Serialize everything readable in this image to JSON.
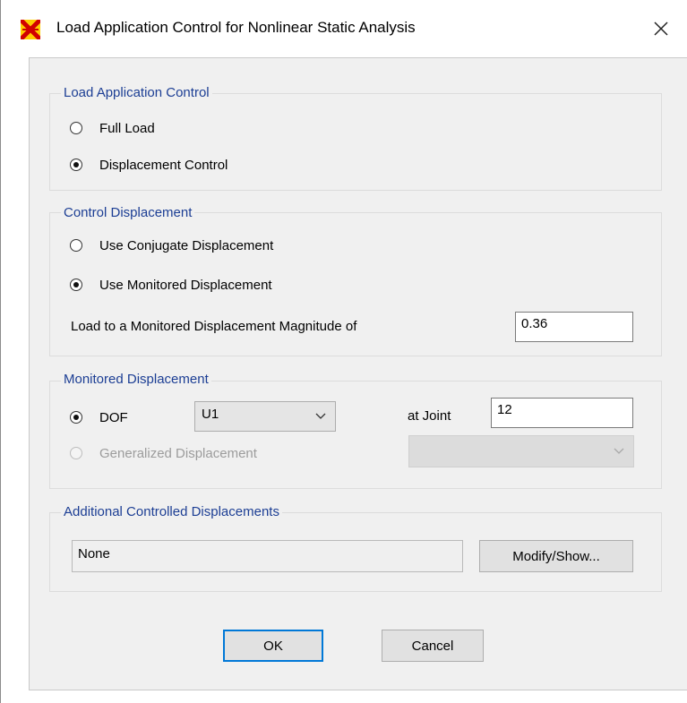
{
  "window": {
    "title": "Load Application Control for Nonlinear Static Analysis"
  },
  "load_application_control": {
    "legend": "Load Application Control",
    "options": [
      {
        "label": "Full Load",
        "selected": false
      },
      {
        "label": "Displacement Control",
        "selected": true
      }
    ]
  },
  "control_displacement": {
    "legend": "Control Displacement",
    "options": [
      {
        "label": "Use Conjugate Displacement",
        "selected": false
      },
      {
        "label": "Use Monitored Displacement",
        "selected": true
      }
    ],
    "magnitude_label": "Load to a Monitored Displacement Magnitude of",
    "magnitude_value": "0.36"
  },
  "monitored_displacement": {
    "legend": "Monitored Displacement",
    "dof_label": "DOF",
    "dof_value": "U1",
    "joint_label": "at Joint",
    "joint_value": "12",
    "generalized_label": "Generalized Displacement",
    "generalized_value": ""
  },
  "additional_controlled": {
    "legend": "Additional Controlled Displacements",
    "value": "None",
    "modify_button": "Modify/Show..."
  },
  "buttons": {
    "ok": "OK",
    "cancel": "Cancel"
  }
}
